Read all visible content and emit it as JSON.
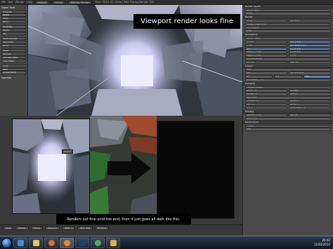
{
  "captions": {
    "top": "Viewport render looks fine",
    "bottom": "Renders out fine until the end, then it just goes all dark like this."
  },
  "topbar": {
    "menu": [
      "File",
      "Add",
      "Render",
      "Help"
    ],
    "layout": "Default",
    "scene": "Scene",
    "engine": "Blender Render",
    "info": "Time: 00:04.40 | Done | Path Tracing Sample 7/20"
  },
  "tool_shelf": {
    "header": "Object Tools",
    "buttons": [
      "Translate",
      "Rotate",
      "Scale",
      "Mirror",
      "Duplicate",
      "Delete",
      "Join",
      "Shade Smooth",
      "Shade Flat",
      "Origin",
      "Insert",
      "Remove",
      "Calculate Paths",
      "Clear Paths",
      "Undo",
      "Redo",
      "Grease Pencil"
    ],
    "footer": "Operator"
  },
  "properties": {
    "sections": [
      {
        "title": "Render Layers",
        "rows": [
          [
            "Render Layers"
          ],
          [
            "Scene"
          ]
        ]
      },
      {
        "title": "Render",
        "rows": [
          [
            "Image",
            "Animation"
          ],
          [
            "Display: Image Editor"
          ],
          [
            "GPU Compute"
          ],
          [
            "CUDA"
          ]
        ]
      },
      {
        "title": "Dimensions",
        "rows": [
          [
            "Render Presets"
          ],
          [
            "X: 1280",
            "Start Frame: 1"
          ],
          [
            "Y: 720",
            "End Frame: 250"
          ],
          [
            "50%",
            "Frame Step: 1"
          ],
          [
            "Aspect X: 1.000",
            "Frame Rate"
          ],
          [
            "Aspect Y: 1.000",
            "25 fps"
          ],
          [
            "Time Remapping"
          ],
          [
            "Old: 100",
            "New: 100"
          ]
        ]
      },
      {
        "title": "Output",
        "rows": [
          [
            "/tmp/"
          ],
          [
            "PNG",
            "File Extensions"
          ],
          [
            "BW",
            "RGB",
            "RGBA"
          ],
          [
            "Compression: 15%"
          ]
        ]
      },
      {
        "title": "Sampling",
        "rows": [
          [
            "Integrator Presets"
          ],
          [
            "Render: 20",
            "Samples"
          ],
          [
            "Preview: 10",
            "Max: 12"
          ],
          [
            "Light Paths"
          ],
          [
            "Transparency",
            "Diffuse: 4"
          ],
          [
            "Max: 12",
            "Glossy: 4"
          ],
          [
            "Min: 1",
            "Transmission: 12"
          ]
        ]
      },
      {
        "title": "Shading",
        "rows": [
          [
            "Exposure: 1.000",
            "Gamma"
          ],
          [
            "Width: 1.50"
          ]
        ]
      },
      {
        "title": "Performance",
        "rows": [
          [
            "Threads"
          ],
          [
            "Tiles"
          ]
        ]
      }
    ]
  },
  "timeline": {
    "items": [
      "View",
      "Marker",
      "Frame",
      "Playback",
      "Start: 1",
      "End: 250",
      "No Sync"
    ]
  },
  "render_thumb_bar": [
    "Global"
  ],
  "taskbar": {
    "apps": [
      "ie",
      "explorer",
      "firefox",
      "blender",
      "photoshop",
      "chrome",
      "folder"
    ],
    "time": "20:42",
    "date": "11/03/2012"
  },
  "colors": {
    "panel": "#4a4a4a",
    "viewport": "#2c3138",
    "accent_blue": "#5680c2",
    "glow": "#e3e2f8"
  }
}
